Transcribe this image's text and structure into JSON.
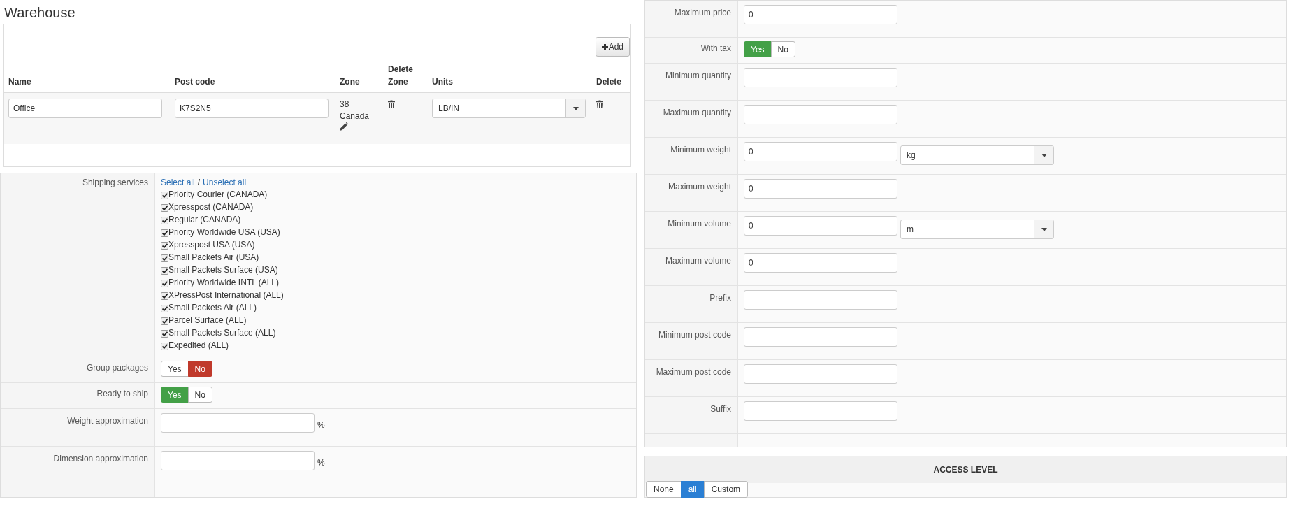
{
  "warehouse": {
    "title": "Warehouse",
    "add_button": "Add",
    "columns": [
      "Name",
      "Post code",
      "Zone",
      "Delete Zone",
      "Units",
      "Delete"
    ],
    "rows": [
      {
        "name": "Office",
        "post_code": "K7S2N5",
        "zone_number": "38",
        "zone_name": "Canada",
        "units": "LB/IN"
      }
    ]
  },
  "shipping_services": {
    "label": "Shipping services",
    "select_all": "Select all",
    "separator": "/",
    "unselect_all": "Unselect all",
    "services": [
      {
        "label": "Priority Courier (CANADA)",
        "checked": true
      },
      {
        "label": "Xpresspost (CANADA)",
        "checked": true
      },
      {
        "label": "Regular (CANADA)",
        "checked": true
      },
      {
        "label": "Priority Worldwide USA (USA)",
        "checked": true
      },
      {
        "label": "Xpresspost USA (USA)",
        "checked": true
      },
      {
        "label": "Small Packets Air (USA)",
        "checked": true
      },
      {
        "label": "Small Packets Surface (USA)",
        "checked": true
      },
      {
        "label": "Priority Worldwide INTL (ALL)",
        "checked": true
      },
      {
        "label": "XPressPost International (ALL)",
        "checked": true
      },
      {
        "label": "Small Packets Air (ALL)",
        "checked": true
      },
      {
        "label": "Parcel Surface (ALL)",
        "checked": true
      },
      {
        "label": "Small Packets Surface (ALL)",
        "checked": true
      },
      {
        "label": "Expedited (ALL)",
        "checked": true
      }
    ]
  },
  "left_fields": [
    {
      "kind": "toggle",
      "label": "Group packages",
      "options": [
        {
          "label": "Yes",
          "kind": "yes",
          "selected": false
        },
        {
          "label": "No",
          "kind": "no",
          "selected": true
        }
      ]
    },
    {
      "kind": "toggle",
      "label": "Ready to ship",
      "options": [
        {
          "label": "Yes",
          "kind": "yes",
          "selected": true
        },
        {
          "label": "No",
          "kind": "no",
          "selected": false
        }
      ]
    },
    {
      "kind": "percent",
      "label": "Weight approximation",
      "unit": "%"
    },
    {
      "kind": "percent",
      "label": "Dimension approximation",
      "unit": "%"
    }
  ],
  "right_fields": [
    {
      "kind": "input",
      "label": "Maximum price",
      "value": "0"
    },
    {
      "kind": "toggle",
      "label": "With tax",
      "options": [
        {
          "label": "Yes",
          "kind": "yes",
          "selected": true
        },
        {
          "label": "No",
          "kind": "no",
          "selected": false
        }
      ]
    },
    {
      "kind": "input",
      "label": "Minimum quantity"
    },
    {
      "kind": "input",
      "label": "Maximum quantity"
    },
    {
      "kind": "input_select",
      "label": "Minimum weight",
      "value": "0",
      "unit": "kg"
    },
    {
      "kind": "input",
      "label": "Maximum weight",
      "value": "0"
    },
    {
      "kind": "input_select",
      "label": "Minimum volume",
      "value": "0",
      "unit": "m"
    },
    {
      "kind": "input",
      "label": "Maximum volume",
      "value": "0"
    },
    {
      "kind": "input",
      "label": "Prefix"
    },
    {
      "kind": "input",
      "label": "Minimum post code"
    },
    {
      "kind": "input",
      "label": "Maximum post code"
    },
    {
      "kind": "input",
      "label": "Suffix"
    }
  ],
  "access_level": {
    "title": "ACCESS LEVEL",
    "options": [
      {
        "label": "None",
        "selected": false
      },
      {
        "label": "all",
        "selected": true
      },
      {
        "label": "Custom",
        "selected": false
      }
    ]
  }
}
